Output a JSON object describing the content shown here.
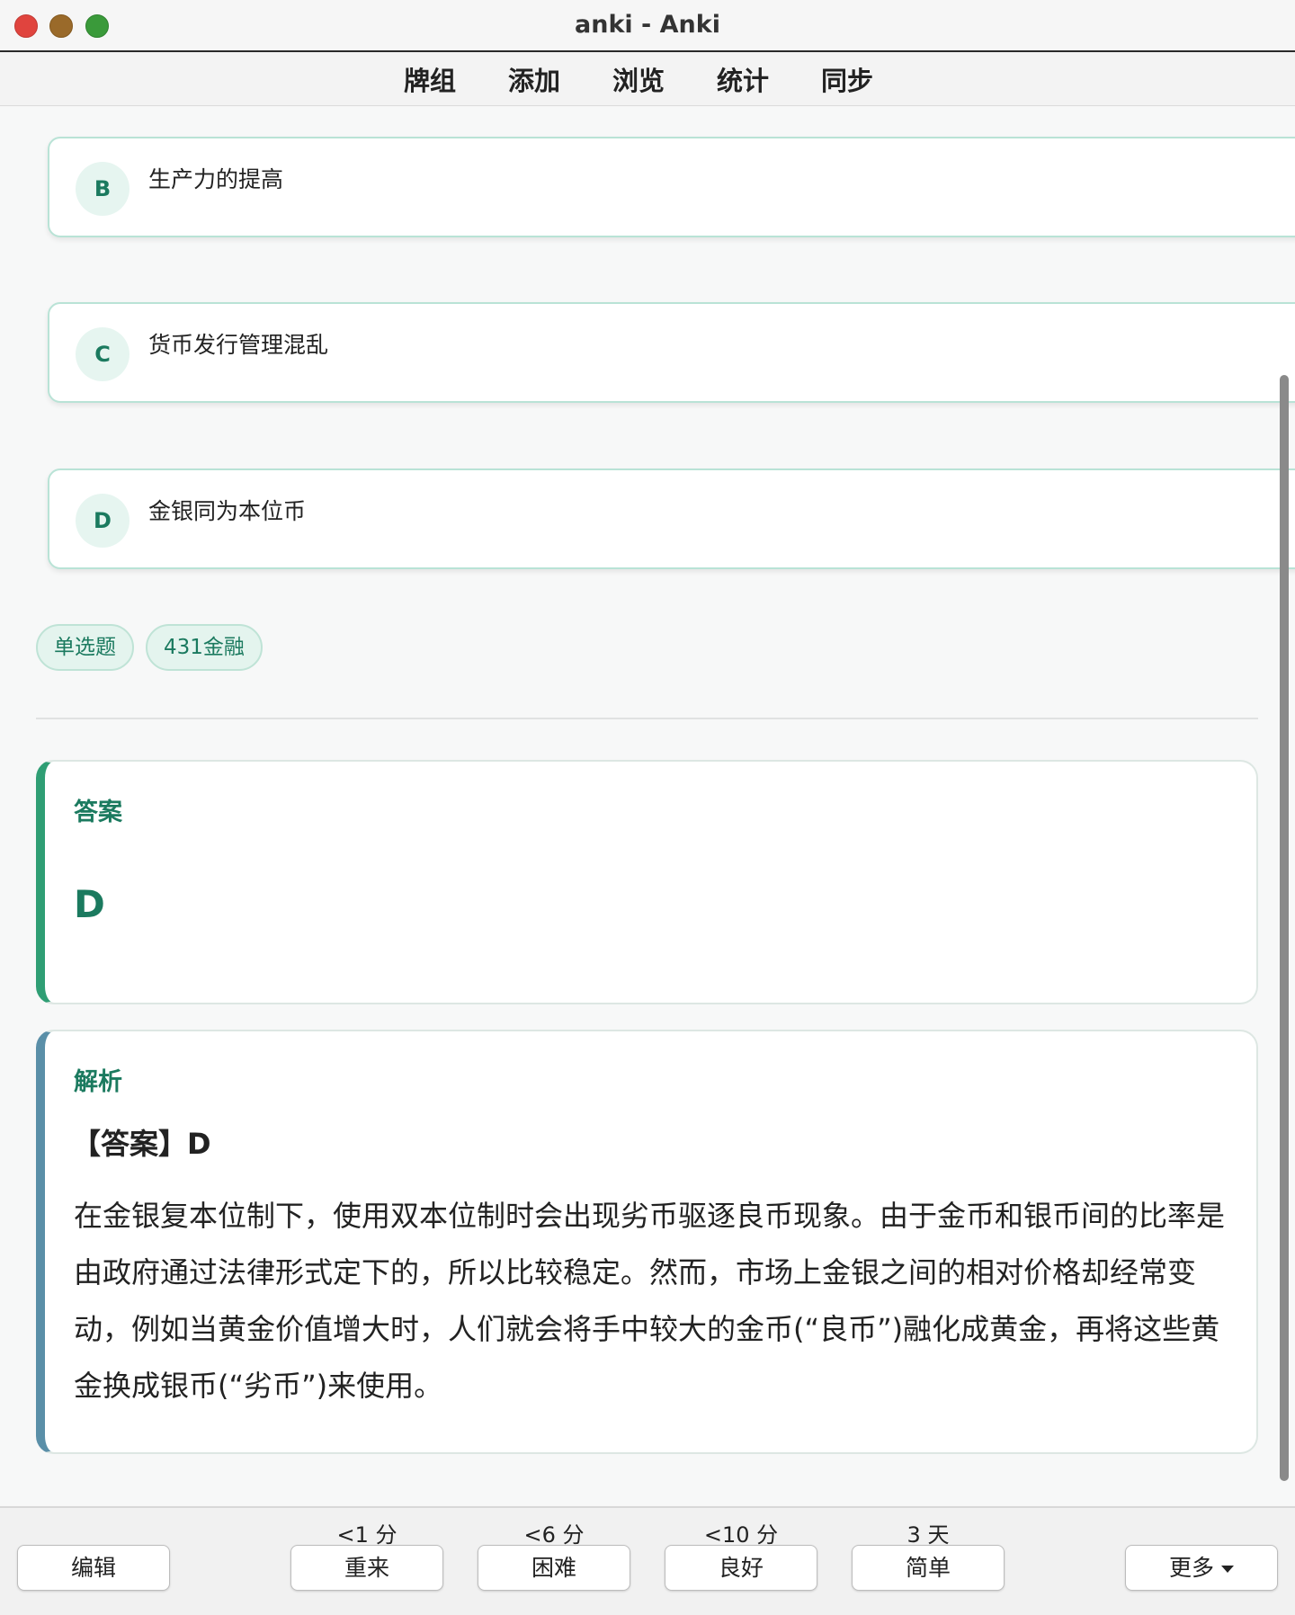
{
  "window": {
    "title": "anki - Anki"
  },
  "nav": [
    "牌组",
    "添加",
    "浏览",
    "统计",
    "同步"
  ],
  "options": [
    {
      "letter": "B",
      "text": "生产力的提高"
    },
    {
      "letter": "C",
      "text": "货币发行管理混乱"
    },
    {
      "letter": "D",
      "text": "金银同为本位币"
    }
  ],
  "tags": [
    "单选题",
    "431金融"
  ],
  "answer": {
    "label": "答案",
    "value": "D"
  },
  "explanation": {
    "label": "解析",
    "heading": "【答案】D",
    "body": "在金银复本位制下，使用双本位制时会出现劣币驱逐良币现象。由于金币和银币间的比率是由政府通过法律形式定下的，所以比较稳定。然而，市场上金银之间的相对价格却经常变动，例如当黄金价值增大时，人们就会将手中较大的金币(“良币”)融化成黄金，再将这些黄金换成银币(“劣币”)来使用。"
  },
  "bottombar": {
    "edit": "编辑",
    "intervals": [
      "<1 分",
      "<6 分",
      "<10 分",
      "3 天"
    ],
    "answers": [
      "重来",
      "困难",
      "良好",
      "简单"
    ],
    "more": "更多"
  },
  "colors": {
    "accent_green": "#1b7a5f",
    "answer_border": "#2f9e74",
    "explain_border": "#5a8fa8"
  }
}
